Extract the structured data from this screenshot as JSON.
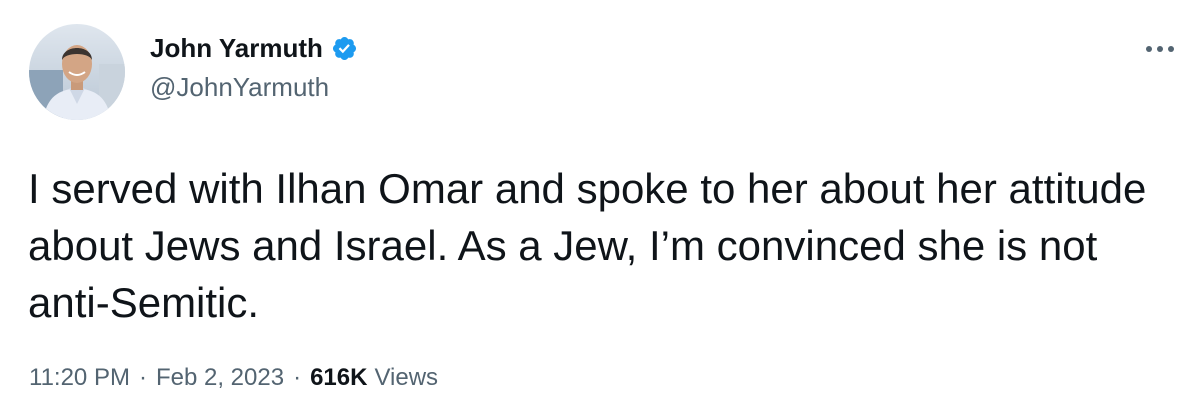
{
  "author": {
    "display_name": "John Yarmuth",
    "handle": "@JohnYarmuth",
    "verified": true,
    "verified_color": "#1d9bf0",
    "avatar_icon": "profile-photo"
  },
  "tweet": {
    "text": "I served with Ilhan Omar and spoke to her about her attitude about Jews and Israel. As a Jew, I’m convinced she is not anti-Semitic."
  },
  "meta": {
    "time": "11:20 PM",
    "separator": "·",
    "date": "Feb 2, 2023",
    "views_count": "616K",
    "views_label": "Views"
  },
  "actions": {
    "more_icon": "more-horizontal-icon"
  },
  "colors": {
    "text_primary": "#0f1419",
    "text_secondary": "#536471",
    "background": "#ffffff"
  }
}
